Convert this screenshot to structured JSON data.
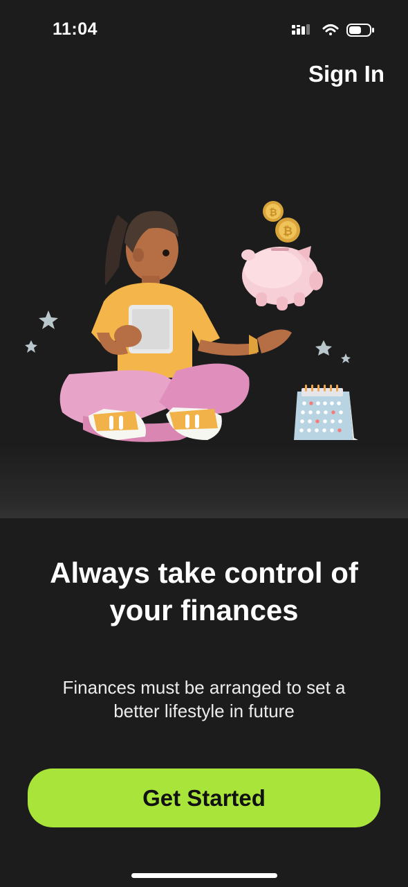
{
  "status_bar": {
    "time": "11:04",
    "icons": [
      "signal-icon",
      "wifi-icon",
      "battery-icon"
    ]
  },
  "header": {
    "sign_in_label": "Sign In"
  },
  "illustration": {
    "subject": "woman-with-tablet-and-piggy-bank",
    "elements": [
      "woman-figure",
      "tablet",
      "piggy-bank",
      "coin",
      "coin",
      "calendar",
      "star",
      "star",
      "star",
      "star"
    ]
  },
  "content": {
    "headline": "Always take control of your finances",
    "subtext": "Finances must be arranged to set a better lifestyle in future"
  },
  "cta": {
    "label": "Get Started"
  },
  "colors": {
    "background": "#1c1c1c",
    "accent": "#a8e43a",
    "text_primary": "#ffffff"
  }
}
